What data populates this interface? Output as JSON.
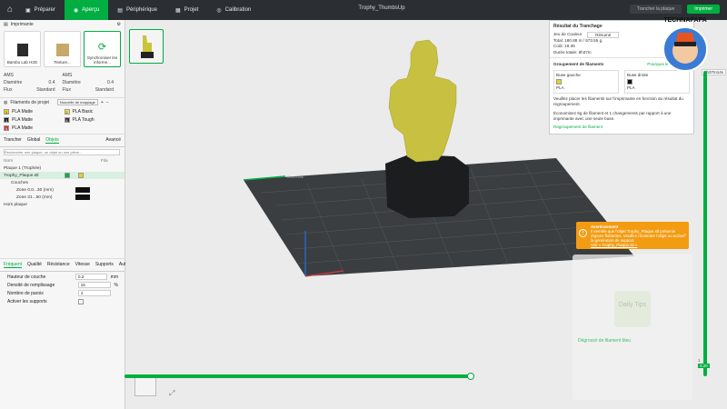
{
  "titlebar": {
    "tabs": [
      {
        "label": "Préparer",
        "icon": "prepare-icon"
      },
      {
        "label": "Aperçu",
        "icon": "preview-icon",
        "active": true
      },
      {
        "label": "Périphérique",
        "icon": "device-icon"
      },
      {
        "label": "Projet",
        "icon": "project-icon"
      },
      {
        "label": "Calibration",
        "icon": "calibration-icon"
      }
    ],
    "window_title": "Trophy_ThumbsUp",
    "slice_label": "Trancher la plaque",
    "print_label": "Imprimer"
  },
  "printer": {
    "header": "Imprimante",
    "cards": [
      "Bambu Lab H2D",
      "Texture...",
      "Synchroniser les informe..."
    ],
    "left": {
      "ams": "AMS",
      "diam_label": "Diamètre",
      "diam_value": "0.4",
      "flux_label": "Flux",
      "flux_value": "Standard"
    },
    "right": {
      "ams": "AMS",
      "diam_label": "Diamètre",
      "diam_value": "0.4",
      "flux_label": "Flux",
      "flux_value": "Standard"
    }
  },
  "filaments": {
    "header": "Filaments de projet",
    "badge": "Nouvelle de mappage",
    "items": [
      {
        "num": "1",
        "name": "PLA Matte",
        "color": "#e8d21e"
      },
      {
        "num": "2",
        "name": "PLA Basic",
        "color": "#f2e641"
      },
      {
        "num": "3",
        "name": "PLA Matte",
        "color": "#111111"
      },
      {
        "num": "4",
        "name": "PLA Tough",
        "color": "#333333"
      },
      {
        "num": "5",
        "name": "PLA Matte",
        "color": "#cc2a2a"
      }
    ]
  },
  "objects": {
    "tabs": [
      "Trancher",
      "Global",
      "Objets"
    ],
    "mode": "Avancé",
    "search_placeholder": "Rechercher une plaque, un objet ou une pièce...",
    "col_name": "Nom",
    "col_fil": "Fila",
    "rows": [
      "Plaque 1 (Trophée)",
      "Trophy_Plaque.stl",
      "Couches",
      "Zone 0.0...30 (mm)",
      "Zone 31...50 (mm)",
      "Hors plaque"
    ]
  },
  "params": {
    "tabs": [
      "Fréquent",
      "Qualité",
      "Résistance",
      "Vitesse",
      "Supports",
      "Autre"
    ],
    "items": [
      {
        "label": "Hauteur de couche",
        "value": "0.2",
        "unit": "mm"
      },
      {
        "label": "Densité de remplissage",
        "value": "15",
        "unit": "%"
      },
      {
        "label": "Nombre de parois",
        "value": "2",
        "unit": ""
      },
      {
        "label": "Activer les supports",
        "value": "",
        "unit": ""
      }
    ]
  },
  "result": {
    "title": "Résultat du Tranchage",
    "dropdown_label": "Jeu de Couleur",
    "dropdown_value": "Résumé",
    "rows": [
      "Total: 180.88 m / 573.55 g",
      "Coût: 16.35",
      "Durée totale: 8h37m"
    ],
    "group_title": "Groupement de filaments",
    "group_link": "Pourquoi le regroupe...",
    "left_slot": "Buse gauche",
    "left_fil": "PLA",
    "right_slot": "Buse droite",
    "right_fil": "PLA",
    "note1": "Veuillez placer les filaments sur l'imprimante en fonction du résultat du regroupement.",
    "note2": "Économisez 6g de filament et 1 changements par rapport à une imprimante avec une seule buse.",
    "note3": "Regroupement de filament"
  },
  "warning": {
    "title": "Avertissement",
    "text": "Il semble que l'objet Trophy_Plaque.stl présente régions flottantes. Veuillez réorienter l'objet ou activer la génération de support.",
    "link": "Voir « Trophy_Plaque.stl »"
  },
  "tips": {
    "title": "Daily Tips",
    "subtitle": "Dégrossir de filament bleu"
  },
  "layer_top": "8h37m14s",
  "layer_num": "1",
  "layer_bottom": "0.20",
  "bed_label": "Bambulab",
  "logo_text": "TECHNAPAPA"
}
